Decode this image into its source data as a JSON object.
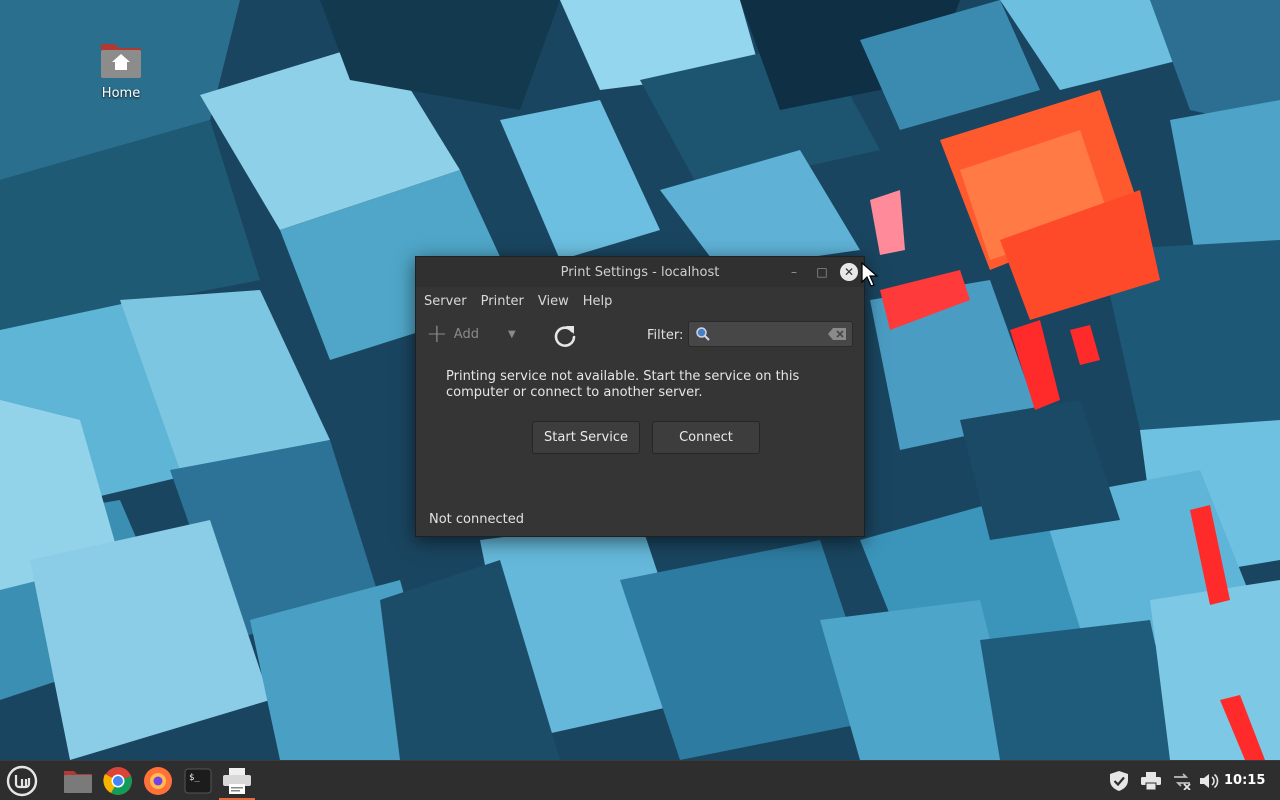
{
  "desktop": {
    "icons": [
      {
        "label": "Home",
        "icon": "home-folder-icon"
      }
    ]
  },
  "window": {
    "title": "Print Settings - localhost",
    "controls": {
      "minimize": "–",
      "maximize": "□",
      "close": "✕"
    },
    "menu": [
      "Server",
      "Printer",
      "View",
      "Help"
    ],
    "toolbar": {
      "add_label": "Add",
      "filter_label": "Filter:",
      "filter_value": ""
    },
    "message": "Printing service not available.  Start the service on this computer or connect to another server.",
    "buttons": {
      "start": "Start Service",
      "connect": "Connect"
    },
    "status": "Not connected"
  },
  "taskbar": {
    "clock": "10:15",
    "apps": [
      "mint-menu-icon",
      "files-icon",
      "chrome-icon",
      "firefox-icon",
      "terminal-icon",
      "printer-settings-icon"
    ],
    "tray": [
      "shield-icon",
      "printer-icon",
      "network-icon",
      "volume-icon"
    ],
    "accent": "#e86a3c"
  }
}
